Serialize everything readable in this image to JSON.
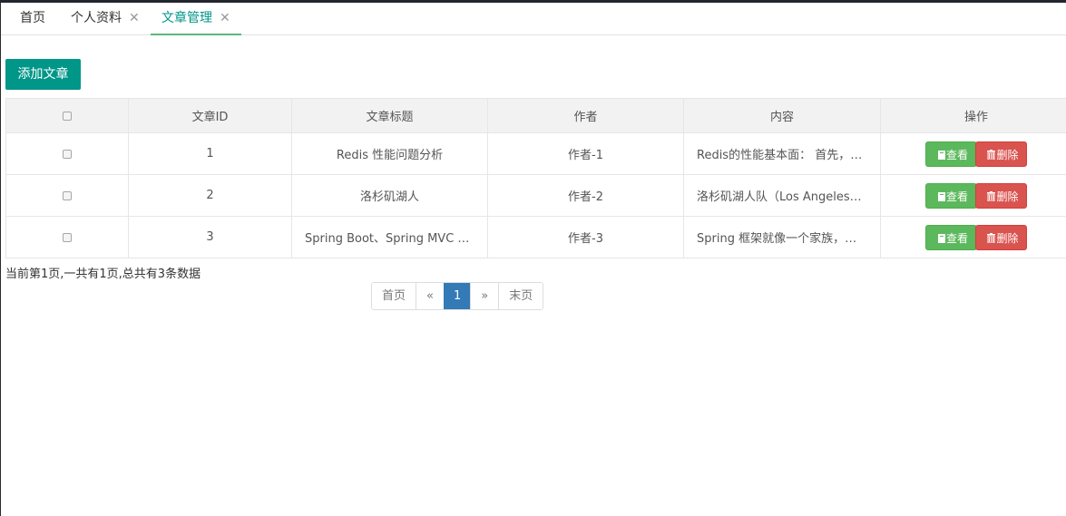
{
  "tabs": [
    {
      "label": "首页",
      "closable": false
    },
    {
      "label": "个人资料",
      "closable": true
    },
    {
      "label": "文章管理",
      "closable": true,
      "active": true
    }
  ],
  "tab_close_glyph": "✕",
  "add_button_label": "添加文章",
  "table": {
    "headers": [
      "",
      "文章ID",
      "文章标题",
      "作者",
      "内容",
      "操作"
    ],
    "rows": [
      {
        "id": "1",
        "title": "Redis 性能问题分析",
        "author": "作者-1",
        "content": "Redis的性能基本面： 首先，Redis的性能问题分析"
      },
      {
        "id": "2",
        "title": "洛杉矶湖人",
        "author": "作者-2",
        "content": "洛杉矶湖人队（Los AngelesLakers）"
      },
      {
        "id": "3",
        "title": "Spring Boot、Spring MVC 和 Spring 有什么区别",
        "author": "作者-3",
        "content": "Spring 框架就像一个家族，有众多衍生产品"
      }
    ],
    "view_label": "查看",
    "delete_label": "删除"
  },
  "page_info": "当前第1页,一共有1页,总共有3条数据",
  "pagination": {
    "first": "首页",
    "prev": "«",
    "current": "1",
    "next": "»",
    "last": "末页"
  },
  "colors": {
    "accent": "#009688",
    "view_button": "#5cb85c",
    "delete_button": "#d9534f",
    "pager_current": "#337ab7"
  }
}
